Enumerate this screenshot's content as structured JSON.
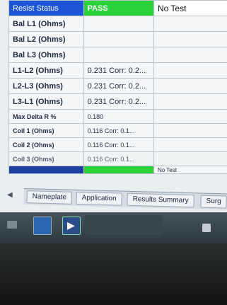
{
  "table": {
    "rows": [
      {
        "label": "Resist Status",
        "v1": "PASS",
        "v2": "No Test"
      },
      {
        "label": "Bal L1 (Ohms)",
        "v1": "",
        "v2": ""
      },
      {
        "label": "Bal L2 (Ohms)",
        "v1": "",
        "v2": ""
      },
      {
        "label": "Bal L3 (Ohms)",
        "v1": "",
        "v2": ""
      },
      {
        "label": "L1-L2 (Ohms)",
        "v1": "0.231 Corr: 0.2...",
        "v2": ""
      },
      {
        "label": "L2-L3 (Ohms)",
        "v1": "0.231 Corr: 0.2...",
        "v2": ""
      },
      {
        "label": "L3-L1 (Ohms)",
        "v1": "0.231 Corr: 0.2...",
        "v2": ""
      },
      {
        "label": "Max Delta R %",
        "v1": "0.180",
        "v2": ""
      },
      {
        "label": "Coil 1 (Ohms)",
        "v1": "0.116 Corr: 0.1...",
        "v2": ""
      },
      {
        "label": "Coil 2 (Ohms)",
        "v1": "0.116 Corr: 0.1...",
        "v2": ""
      },
      {
        "label": "Coil 3 (Ohms)",
        "v1": "0.116 Corr: 0.1...",
        "v2": ""
      },
      {
        "label": "",
        "v1": "",
        "v2": "No Test"
      }
    ]
  },
  "tabs": {
    "nameplate": "Nameplate",
    "application": "Application",
    "results_summary": "Results Summary",
    "surge": "Surg"
  },
  "colors": {
    "header_label": "#1c56d6",
    "pass": "#2bd23a",
    "label_bg": "#dde3f0"
  },
  "icons": {
    "scroll_left": "triangle-left",
    "taskbar_video": "video-icon",
    "taskbar_media": "media-player-icon",
    "taskbar_lock": "lock-icon"
  }
}
